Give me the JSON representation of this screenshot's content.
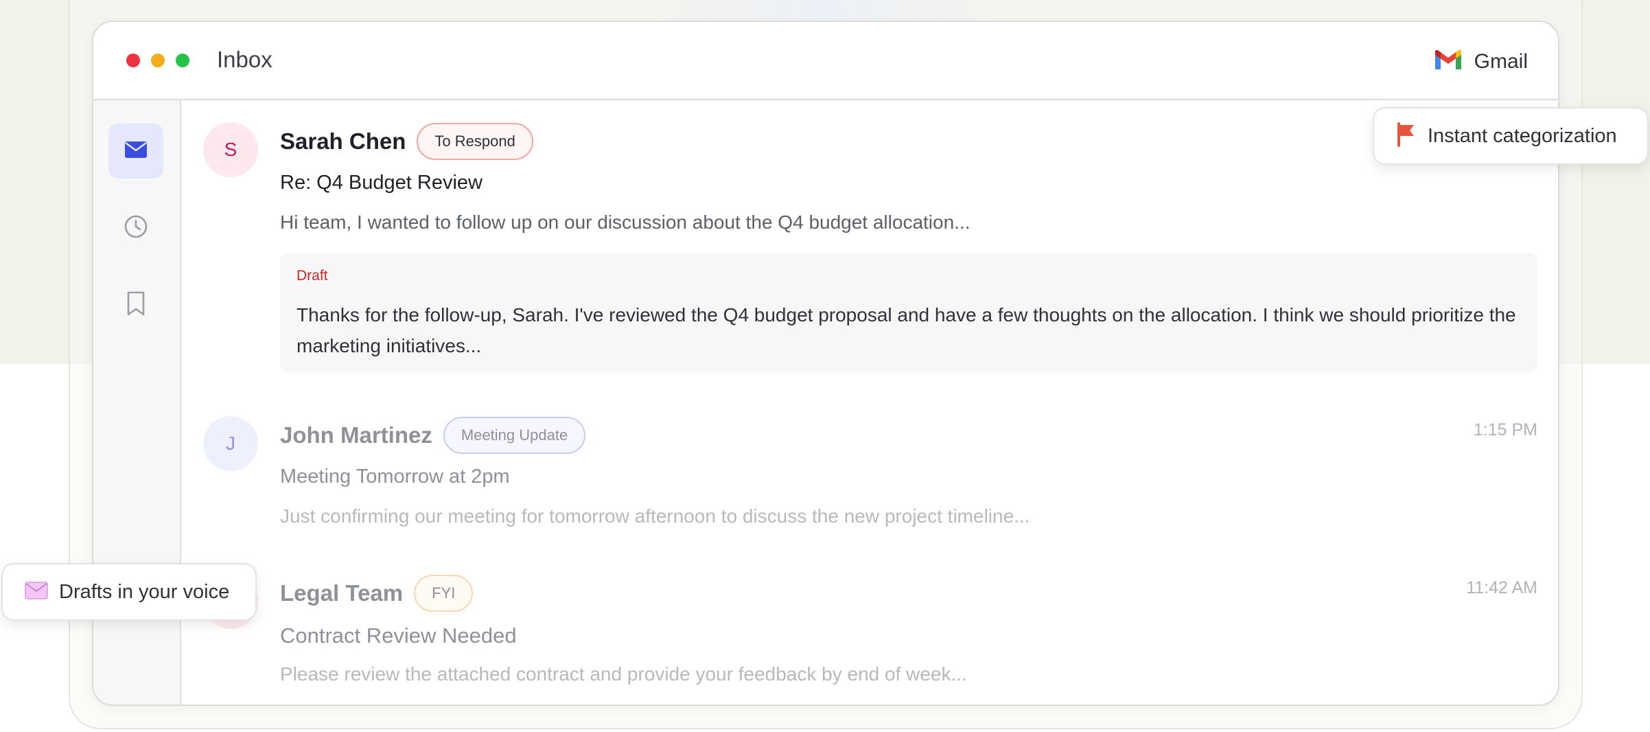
{
  "window": {
    "title": "Inbox",
    "app_name": "Gmail"
  },
  "sidebar": {
    "items": [
      {
        "icon": "mail-icon",
        "active": true
      },
      {
        "icon": "clock-icon",
        "active": false
      },
      {
        "icon": "bookmark-icon",
        "active": false
      }
    ]
  },
  "emails": [
    {
      "avatar_initial": "S",
      "sender": "Sarah Chen",
      "tag": "To Respond",
      "subject": "Re: Q4 Budget Review",
      "preview": "Hi team, I wanted to follow up on our discussion about the Q4 budget allocation...",
      "time": "",
      "draft_label": "Draft",
      "draft_text": "Thanks for the follow-up, Sarah. I've reviewed the Q4 budget proposal and have a few thoughts on the allocation. I think we should prioritize the marketing initiatives..."
    },
    {
      "avatar_initial": "J",
      "sender": "John Martinez",
      "tag": "Meeting Update",
      "subject": "Meeting Tomorrow at 2pm",
      "preview": "Just confirming our meeting for tomorrow afternoon to discuss the new project timeline...",
      "time": "1:15 PM"
    },
    {
      "avatar_initial": "",
      "sender": "Legal Team",
      "tag": "FYI",
      "subject": "Contract Review Needed",
      "preview": "Please review the attached contract and provide your feedback by end of week...",
      "time": "11:42 AM"
    }
  ],
  "badges": {
    "categorization": "Instant categorization",
    "drafts": "Drafts in your voice"
  },
  "colors": {
    "tag_to_respond": "#e45a4f",
    "tag_meeting_update": "#8f96e8",
    "tag_fyi": "#f1c48a",
    "draft_label": "#cc2529",
    "active_nav": "#3b4de0"
  }
}
